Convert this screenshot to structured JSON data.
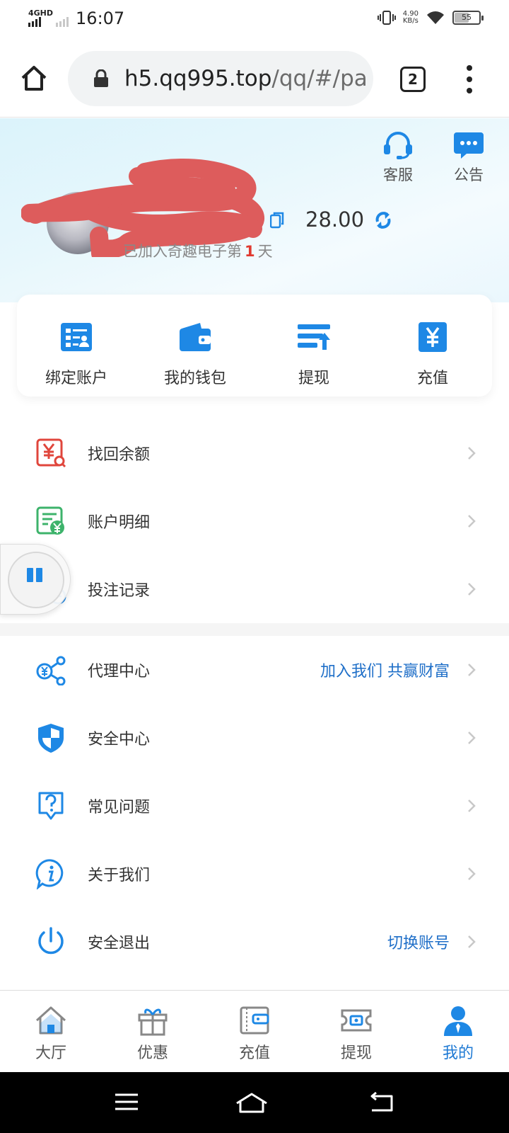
{
  "status_bar": {
    "network": "4GHD",
    "time": "16:07",
    "speed_value": "4.90",
    "speed_unit": "KB/s",
    "battery": "55"
  },
  "browser": {
    "url_host": "h5.qq995.top",
    "url_path": "/qq/#/pa",
    "tab_count": "2"
  },
  "header": {
    "customer_service": "客服",
    "announcement": "公告",
    "balance": "28.00",
    "joined_prefix": "已加入奇趣电子第",
    "joined_days": "1",
    "joined_suffix": "天"
  },
  "quick_actions": [
    {
      "label": "绑定账户",
      "icon": "bind-account-icon"
    },
    {
      "label": "我的钱包",
      "icon": "wallet-icon"
    },
    {
      "label": "提现",
      "icon": "withdraw-icon"
    },
    {
      "label": "充值",
      "icon": "recharge-icon"
    }
  ],
  "menu_group1": [
    {
      "label": "找回余额",
      "icon": "recover-balance-icon"
    },
    {
      "label": "账户明细",
      "icon": "account-detail-icon"
    },
    {
      "label": "投注记录",
      "icon": "bet-record-icon"
    }
  ],
  "menu_group2": [
    {
      "label": "代理中心",
      "sub": "加入我们 共赢财富",
      "icon": "agent-icon"
    },
    {
      "label": "安全中心",
      "sub": "",
      "icon": "shield-icon"
    },
    {
      "label": "常见问题",
      "sub": "",
      "icon": "question-icon"
    },
    {
      "label": "关于我们",
      "sub": "",
      "icon": "info-icon"
    },
    {
      "label": "安全退出",
      "sub": "切换账号",
      "icon": "power-icon"
    }
  ],
  "tab_bar": [
    {
      "label": "大厅",
      "icon": "home-icon",
      "active": false
    },
    {
      "label": "优惠",
      "icon": "gift-icon",
      "active": false
    },
    {
      "label": "充值",
      "icon": "recharge-wallet-icon",
      "active": false
    },
    {
      "label": "提现",
      "icon": "withdraw-ticket-icon",
      "active": false
    },
    {
      "label": "我的",
      "icon": "user-icon",
      "active": true
    }
  ],
  "colors": {
    "accent": "#1f7ad4",
    "icon_blue": "#1e88e5",
    "highlight_red": "#e0392f",
    "icon_green": "#3db36b"
  }
}
